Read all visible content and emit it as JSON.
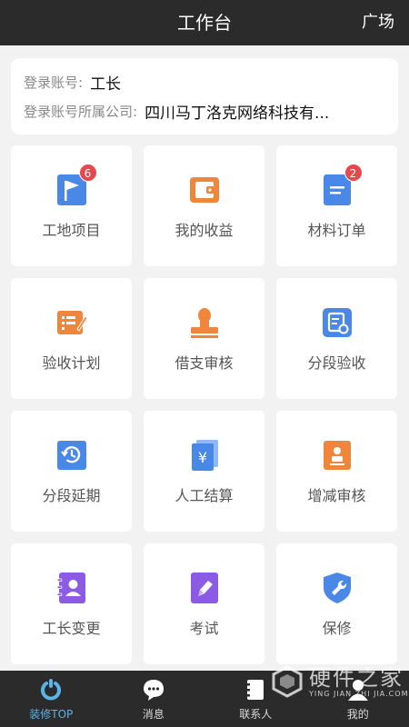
{
  "header": {
    "title": "工作台",
    "right_link": "广场"
  },
  "account": {
    "login_label": "登录账号:",
    "login_value": "工长",
    "company_label": "登录账号所属公司:",
    "company_value": "四川马丁洛克网络科技有..."
  },
  "tiles": [
    {
      "label": "工地项目",
      "icon": "flag-icon",
      "color": "#4a88e8",
      "badge": "6"
    },
    {
      "label": "我的收益",
      "icon": "wallet-icon",
      "color": "#f0863b"
    },
    {
      "label": "材料订单",
      "icon": "order-list-icon",
      "color": "#4a88e8",
      "badge": "2"
    },
    {
      "label": "验收计划",
      "icon": "plan-edit-icon",
      "color": "#f0863b"
    },
    {
      "label": "借支审核",
      "icon": "stamp-icon",
      "color": "#f0863b"
    },
    {
      "label": "分段验收",
      "icon": "checklist-icon",
      "color": "#4a88e8"
    },
    {
      "label": "分段延期",
      "icon": "history-clock-icon",
      "color": "#4a88e8"
    },
    {
      "label": "人工结算",
      "icon": "yuan-bill-icon",
      "color": "#4a88e8"
    },
    {
      "label": "增减审核",
      "icon": "person-doc-icon",
      "color": "#f0863b"
    },
    {
      "label": "工长变更",
      "icon": "contact-book-icon",
      "color": "#8b5be6"
    },
    {
      "label": "考试",
      "icon": "pen-paper-icon",
      "color": "#8b5be6"
    },
    {
      "label": "保修",
      "icon": "wrench-shield-icon",
      "color": "#4a88e8"
    }
  ],
  "tabbar": [
    {
      "label": "装修TOP",
      "icon": "home-ring-icon",
      "active": true
    },
    {
      "label": "消息",
      "icon": "chat-bubble-icon",
      "active": false
    },
    {
      "label": "联系人",
      "icon": "contacts-icon",
      "active": false
    },
    {
      "label": "我的",
      "icon": "user-icon",
      "active": false
    }
  ],
  "watermark": {
    "main": "硬件之家",
    "sub": "YING JIAN ZHI JIA.COM"
  },
  "colors": {
    "header_bg": "#2b2b2b",
    "active_tab": "#5bb4e5",
    "badge": "#e5484d"
  }
}
